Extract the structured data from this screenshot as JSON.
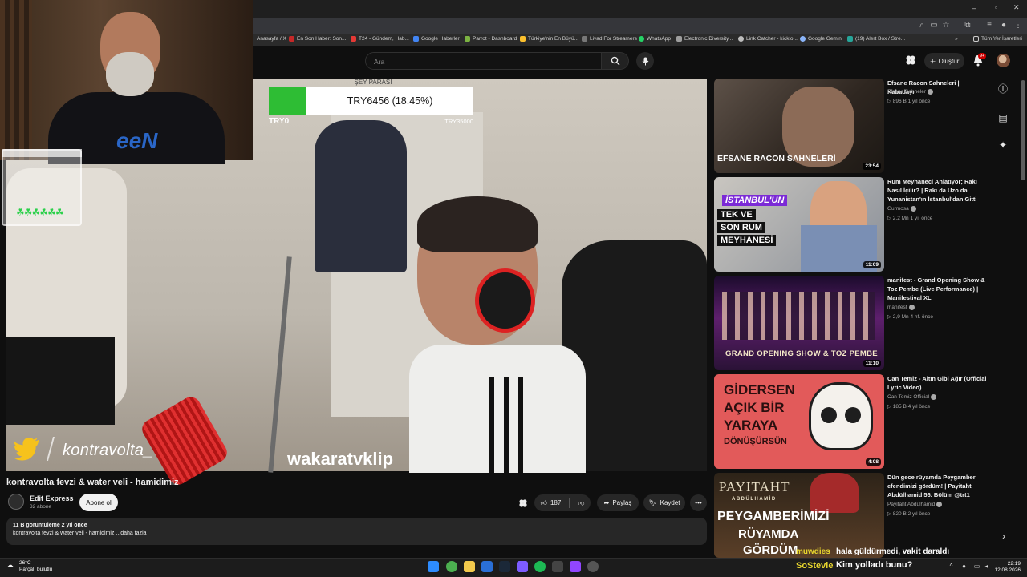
{
  "browser": {
    "bookmarks": [
      {
        "label": "Anasayfa / X",
        "color": "#000000"
      },
      {
        "label": "En Son Haber: Son...",
        "color": "#c62828"
      },
      {
        "label": "T24 - Gündem, Hab...",
        "color": "#e53935"
      },
      {
        "label": "Google Haberler",
        "color": "#4285f4"
      },
      {
        "label": "Parrot - Dashboard",
        "color": "#7cb342"
      },
      {
        "label": "Türkiye'nin En Büyü...",
        "color": "#fbc02d"
      },
      {
        "label": "Livad For Streamers",
        "color": "#333333"
      },
      {
        "label": "WhatsApp",
        "color": "#25d366"
      },
      {
        "label": "Electronic Diversity...",
        "color": "#9e9e9e"
      },
      {
        "label": "Link Catcher - kicklo...",
        "color": "#bdbdbd"
      },
      {
        "label": "Google Gemini",
        "color": "#8ab4f8"
      },
      {
        "label": "(19) Alert Box / Stre...",
        "color": "#26a69a"
      }
    ],
    "other_bookmarks": "Tüm Yer İşaretleri",
    "more_bookmarks": "»"
  },
  "youtube_header": {
    "search_placeholder": "Ara",
    "create_label": "Oluştur",
    "notification_badge": "9+"
  },
  "stream_overlay": {
    "goal_title": "ŞEY PARASI",
    "goal_text": "TRY6456 (18.45%)",
    "goal_progress": 0.1845,
    "goal_min": "TRY0",
    "goal_max": "TRY35000",
    "twitter_handle": "kontravolta_",
    "watermark": "wakaratvklip",
    "webcam_shirt": "eeN",
    "clovers": "☘☘☘☘☘☘"
  },
  "video": {
    "title": "kontravolta fevzi & water veli - hamidimiz",
    "channel_name": "Edit Express",
    "subscribers": "32 abone",
    "subscribe_label": "Abone ol",
    "likes": "187",
    "share_label": "Paylaş",
    "save_label": "Kaydet",
    "more_label": "•••",
    "views_date": "11 B görüntüleme  2 yıl önce",
    "description": "kontravolta fevzi & water veli - hamidimiz ...daha fazla"
  },
  "related": [
    {
      "title": "Efsane Racon Sahneleri | Kabadayı",
      "channel": "Efsane Sahneler",
      "meta": "▷ 896 B  1 yıl önce",
      "duration": "23:54",
      "thumb_text": "EFSANE RACON SAHNELERİ"
    },
    {
      "title": "Rum Meyhaneci Anlatıyor; Rakı Nasıl İçilir? | Rakı da Uzo da Yunanistan'ın İstanbul'dan Gitti",
      "channel": "Gurmosa",
      "meta": "▷ 2,2 Mn  1 yıl önce",
      "duration": "11:09",
      "thumb_lines": [
        "İSTANBUL'UN",
        "TEK VE",
        "SON RUM",
        "MEYHANESİ"
      ]
    },
    {
      "title": "manifest - Grand Opening Show & Toz Pembe (Live Performance) | Manifestival XL",
      "channel": "manifest",
      "meta": "▷ 2,9 Mn  4 hf. önce",
      "duration": "11:10",
      "thumb_text": "GRAND OPENING SHOW & TOZ PEMBE"
    },
    {
      "title": "Can Temiz - Altın Gibi Ağır (Official Lyric Video)",
      "channel": "Can Temiz Official",
      "meta": "▷ 185 B  4 yıl önce",
      "duration": "4:08",
      "thumb_lines": [
        "GİDERSEN",
        "AÇIK BİR",
        "YARAYA",
        "DÖNÜŞÜRSÜN"
      ]
    },
    {
      "title": "Dün gece rüyamda Peygamber efendimizi gördüm! | Payitaht Abdülhamid 56. Bölüm @trt1",
      "channel": "Payitaht Abdülhamid",
      "meta": "▷ 820 B  2 yıl önce",
      "duration": "",
      "thumb_lines": [
        "PAYITAHT",
        "ABDÜLHAMİD",
        "PEYGAMBERİMİZİ",
        "RÜYAMDA",
        "GÖRDÜM"
      ]
    }
  ],
  "chat": [
    {
      "user": "muwdies",
      "message": "hala güldürmedi, vakit daraldı"
    },
    {
      "user": "SoStevie",
      "message": "Kim yolladı bunu?"
    }
  ],
  "taskbar": {
    "temperature": "26°C",
    "weather": "Parçalı bulutlu",
    "time": "22:19",
    "date": "12.08.2026"
  },
  "colors": {
    "background": "#0f0f0f",
    "goal_fill": "#2ebd34",
    "chat_user": "#e7d52e",
    "accent_red": "#cc0000"
  }
}
